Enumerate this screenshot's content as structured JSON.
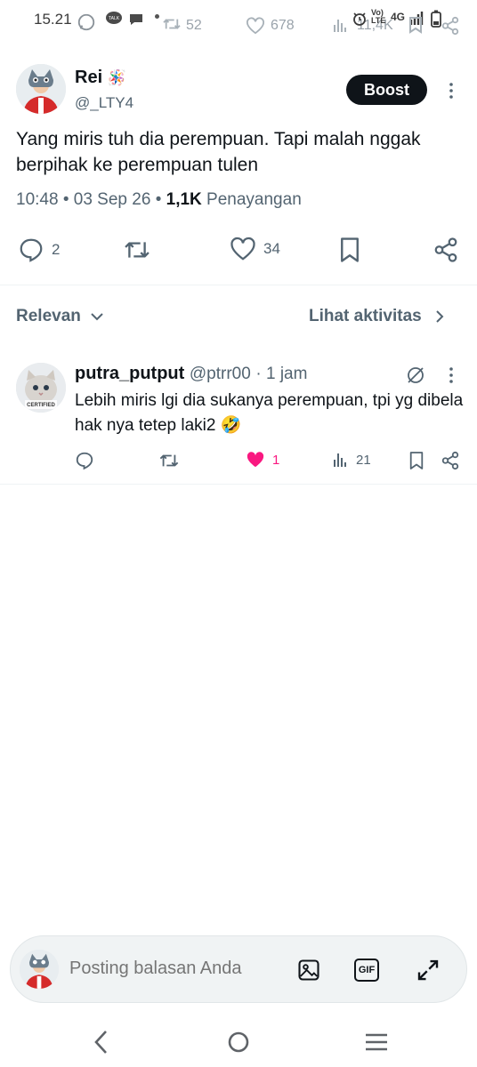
{
  "status_bar": {
    "time": "15.21",
    "bg_retweets": "52",
    "bg_likes": "678",
    "bg_views": "11,4K",
    "network": "4G"
  },
  "tweet": {
    "author_name": "Rei",
    "author_badge_emoji": "🪅",
    "author_handle": "@_LTY4",
    "boost_label": "Boost",
    "text": "Yang miris tuh dia perempuan. Tapi malah nggak berpihak ke perempuan tulen",
    "time": "10:48",
    "date": "03 Sep 26",
    "views_count": "1,1K",
    "views_label": "Penayangan",
    "replies": "2",
    "likes": "34"
  },
  "sort": {
    "label": "Relevan",
    "activity_link": "Lihat aktivitas"
  },
  "reply": {
    "name": "putra_putput",
    "handle": "@ptrr00",
    "time": "1 jam",
    "text": "Lebih miris lgi dia sukanya perempuan, tpi yg dibela hak nya tetep laki2 🤣",
    "likes": "1",
    "views": "21"
  },
  "composer": {
    "placeholder": "Posting balasan Anda",
    "gif_label": "GIF"
  },
  "colors": {
    "text_primary": "#0f1419",
    "text_secondary": "#536471",
    "like_active": "#f91880",
    "divider": "#eff3f4"
  }
}
